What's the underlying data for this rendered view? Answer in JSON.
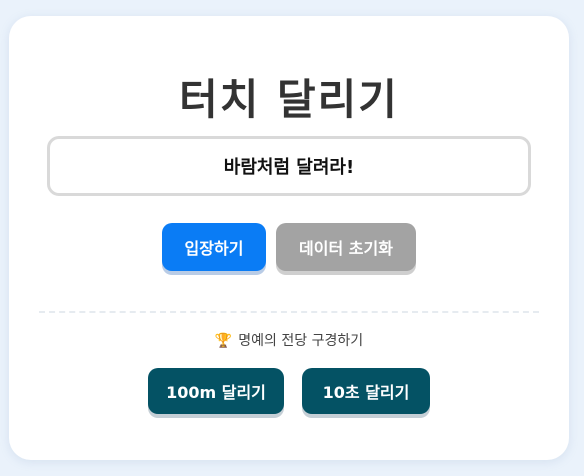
{
  "title": "터치 달리기",
  "name_input": {
    "value": "바람처럼 달려라!"
  },
  "buttons": {
    "enter": "입장하기",
    "reset": "데이터 초기화",
    "run_100m": "100m 달리기",
    "run_10s": "10초 달리기"
  },
  "hall_of_fame": {
    "icon": "trophy-icon",
    "glyph": "🏆",
    "label": "명예의 전당 구경하기"
  },
  "colors": {
    "primary": "#0a7cf5",
    "secondary": "#a3a3a3",
    "dark": "#045264"
  }
}
